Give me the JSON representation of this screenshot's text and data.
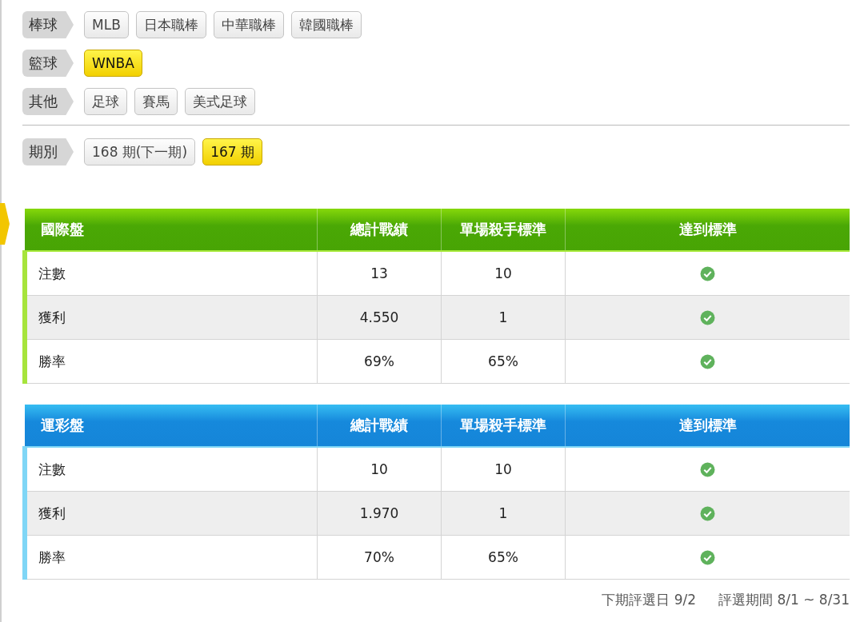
{
  "filters": [
    {
      "label": "棒球",
      "options": [
        {
          "label": "MLB",
          "selected": false
        },
        {
          "label": "日本職棒",
          "selected": false
        },
        {
          "label": "中華職棒",
          "selected": false
        },
        {
          "label": "韓國職棒",
          "selected": false
        }
      ]
    },
    {
      "label": "籃球",
      "options": [
        {
          "label": "WNBA",
          "selected": true
        }
      ]
    },
    {
      "label": "其他",
      "options": [
        {
          "label": "足球",
          "selected": false
        },
        {
          "label": "賽馬",
          "selected": false
        },
        {
          "label": "美式足球",
          "selected": false
        }
      ]
    }
  ],
  "period": {
    "label": "期別",
    "options": [
      {
        "label": "168 期(下一期)",
        "selected": false
      },
      {
        "label": "167 期",
        "selected": true
      }
    ]
  },
  "tables": [
    {
      "kind": "international",
      "columns": [
        "國際盤",
        "總計戰績",
        "單場殺手標準",
        "達到標準"
      ],
      "rows": [
        {
          "label": "注數",
          "total": "13",
          "standard": "10",
          "met": true
        },
        {
          "label": "獲利",
          "total": "4.550",
          "standard": "1",
          "met": true
        },
        {
          "label": "勝率",
          "total": "69%",
          "standard": "65%",
          "met": true
        }
      ]
    },
    {
      "kind": "sports_lottery",
      "columns": [
        "運彩盤",
        "總計戰績",
        "單場殺手標準",
        "達到標準"
      ],
      "rows": [
        {
          "label": "注數",
          "total": "10",
          "standard": "10",
          "met": true
        },
        {
          "label": "獲利",
          "total": "1.970",
          "standard": "1",
          "met": true
        },
        {
          "label": "勝率",
          "total": "70%",
          "standard": "65%",
          "met": true
        }
      ]
    }
  ],
  "footer": {
    "next_date": "下期評選日 9/2",
    "period": "評選期間 8/1 ~ 8/31"
  }
}
